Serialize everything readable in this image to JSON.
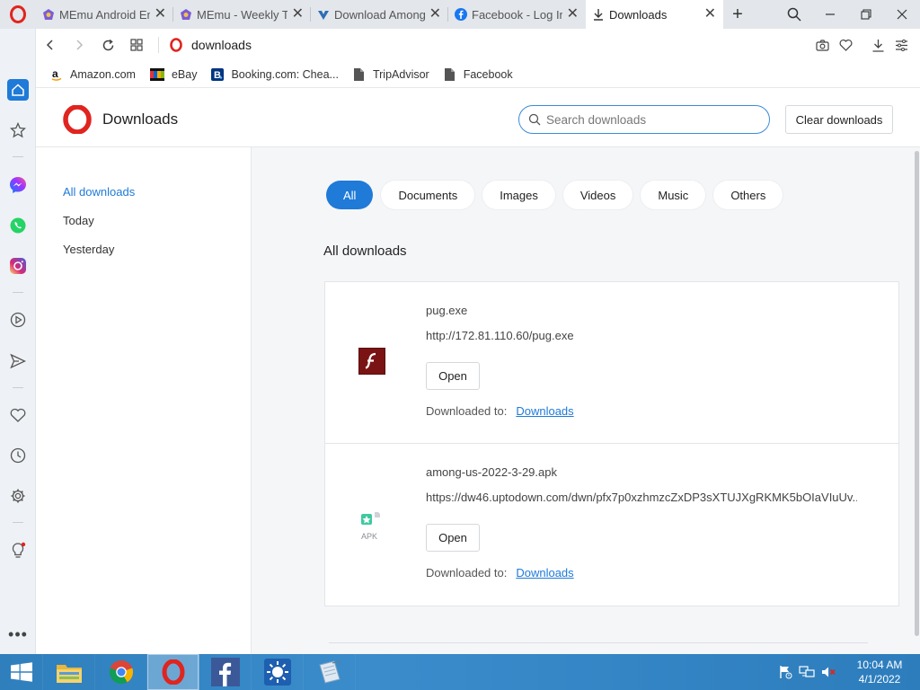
{
  "tabs": [
    {
      "title": "MEmu Android Em",
      "icon": "memu-icon",
      "active": false
    },
    {
      "title": "MEmu - Weekly To",
      "icon": "memu-icon",
      "active": false
    },
    {
      "title": "Download Among",
      "icon": "uptodown-icon",
      "active": false
    },
    {
      "title": "Facebook - Log In",
      "icon": "facebook-icon",
      "active": false
    },
    {
      "title": "Downloads",
      "icon": "download-icon",
      "active": true
    }
  ],
  "address": {
    "url": "downloads"
  },
  "bookmarks": [
    {
      "label": "Amazon.com",
      "icon": "amazon-icon"
    },
    {
      "label": "eBay",
      "icon": "ebay-icon"
    },
    {
      "label": "Booking.com: Chea...",
      "icon": "booking-icon"
    },
    {
      "label": "TripAdvisor",
      "icon": "page-icon"
    },
    {
      "label": "Facebook",
      "icon": "page-icon"
    }
  ],
  "page": {
    "title": "Downloads",
    "search_placeholder": "Search downloads",
    "clear_label": "Clear downloads"
  },
  "left_nav": {
    "items": [
      {
        "label": "All downloads",
        "active": true
      },
      {
        "label": "Today",
        "active": false
      },
      {
        "label": "Yesterday",
        "active": false
      }
    ]
  },
  "filters": [
    {
      "label": "All",
      "active": true
    },
    {
      "label": "Documents",
      "active": false
    },
    {
      "label": "Images",
      "active": false
    },
    {
      "label": "Videos",
      "active": false
    },
    {
      "label": "Music",
      "active": false
    },
    {
      "label": "Others",
      "active": false
    }
  ],
  "section_title": "All downloads",
  "downloads": [
    {
      "name": "pug.exe",
      "url": "http://172.81.110.60/pug.exe",
      "open_label": "Open",
      "saved_label": "Downloaded to:",
      "folder": "Downloads",
      "icon": "flash-icon"
    },
    {
      "name": "among-us-2022-3-29.apk",
      "url": "https://dw46.uptodown.com/dwn/pfx7p0xzhmzcZxDP3sXTUJXgRKMK5bOIaVIuUv...",
      "open_label": "Open",
      "saved_label": "Downloaded to:",
      "folder": "Downloads",
      "icon": "apk-icon",
      "icon_text": "APK"
    }
  ],
  "taskbar": {
    "time": "10:04 AM",
    "date": "4/1/2022"
  },
  "colors": {
    "accent": "#1f7ad8",
    "opera_red": "#e0241f",
    "taskbar": "#2f7fbd"
  }
}
